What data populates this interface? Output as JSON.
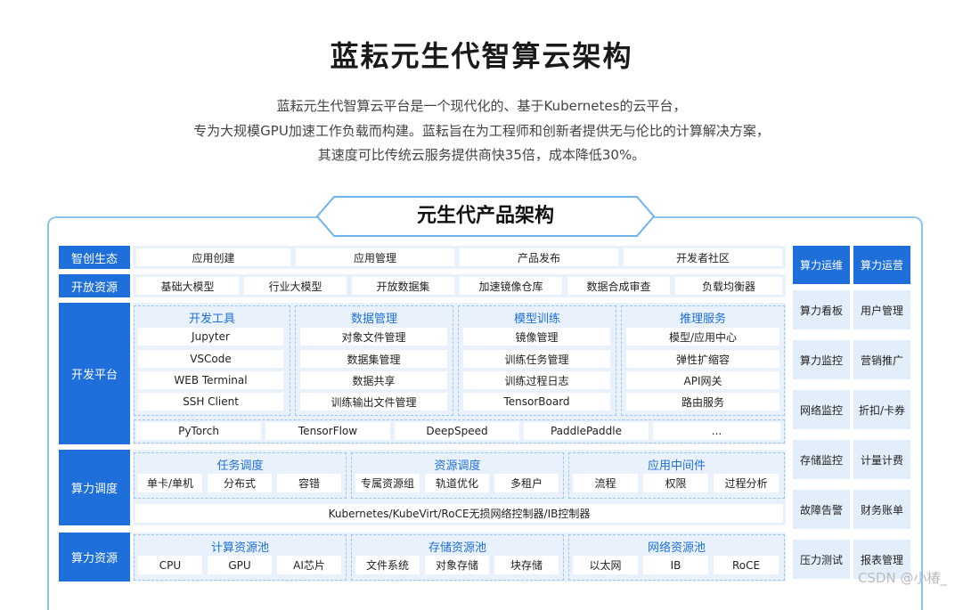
{
  "title": "蓝耘元生代智算云架构",
  "description": [
    "蓝耘元生代智算云平台是一个现代化的、基于Kubernetes的云平台，",
    "专为大规模GPU加速工作负载而构建。蓝耘旨在为工程师和创新者提供无与伦比的计算解决方案，",
    "其速度可比传统云服务提供商快35倍，成本降低30%。"
  ],
  "diagram_title": "元生代产品架构",
  "rows": {
    "ecosystem": {
      "label": "智创生态",
      "items": [
        "应用创建",
        "应用管理",
        "产品发布",
        "开发者社区"
      ]
    },
    "open": {
      "label": "开放资源",
      "items": [
        "基础大模型",
        "行业大模型",
        "开放数据集",
        "加速镜像仓库",
        "数据合成审查",
        "负载均衡器"
      ]
    },
    "dev": {
      "label": "开发平台",
      "groups": [
        {
          "title": "开发工具",
          "items": [
            "Jupyter",
            "VSCode",
            "WEB Terminal",
            "SSH Client"
          ]
        },
        {
          "title": "数据管理",
          "items": [
            "对象文件管理",
            "数据集管理",
            "数据共享",
            "训练输出文件管理"
          ]
        },
        {
          "title": "模型训练",
          "items": [
            "镜像管理",
            "训练任务管理",
            "训练过程日志",
            "TensorBoard"
          ]
        },
        {
          "title": "推理服务",
          "items": [
            "模型/应用中心",
            "弹性扩缩容",
            "API网关",
            "路由服务"
          ]
        }
      ],
      "frameworks": [
        "PyTorch",
        "TensorFlow",
        "DeepSpeed",
        "PaddlePaddle",
        "..."
      ]
    },
    "schedule": {
      "label": "算力调度",
      "groups": [
        {
          "title": "任务调度",
          "items": [
            "单卡/单机",
            "分布式",
            "容错"
          ]
        },
        {
          "title": "资源调度",
          "items": [
            "专属资源组",
            "轨道优化",
            "多租户"
          ]
        },
        {
          "title": "应用中间件",
          "items": [
            "流程",
            "权限",
            "过程分析"
          ]
        }
      ],
      "bottom": "Kubernetes/KubeVirt/RoCE无损网络控制器/IB控制器"
    },
    "resource": {
      "label": "算力资源",
      "groups": [
        {
          "title": "计算资源池",
          "items": [
            "CPU",
            "GPU",
            "AI芯片"
          ]
        },
        {
          "title": "存储资源池",
          "items": [
            "文件系统",
            "对象存储",
            "块存储"
          ]
        },
        {
          "title": "网络资源池",
          "items": [
            "以太网",
            "IB",
            "RoCE"
          ]
        }
      ]
    }
  },
  "right": {
    "col1": {
      "header": "算力运维",
      "items": [
        "算力看板",
        "算力监控",
        "网络监控",
        "存储监控",
        "故障告警",
        "压力测试"
      ]
    },
    "col2": {
      "header": "算力运营",
      "items": [
        "用户管理",
        "营销推广",
        "折扣/卡券",
        "计量计费",
        "财务账单",
        "报表管理"
      ]
    }
  },
  "watermark": "CSDN @小椿_",
  "colors": {
    "accent": "#1e6fd9",
    "band": "#e8f1fc",
    "frame": "#8cc4f0"
  }
}
